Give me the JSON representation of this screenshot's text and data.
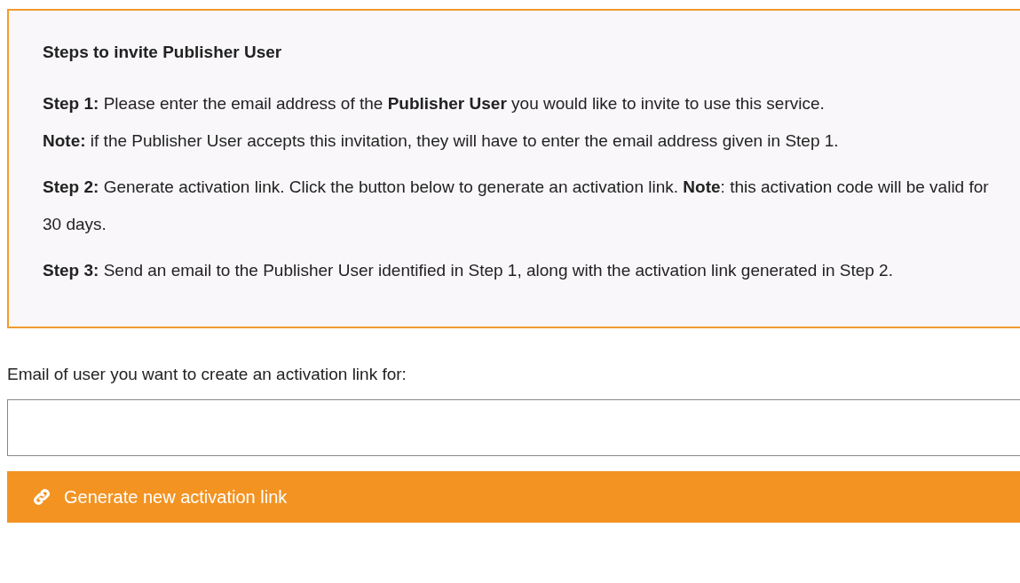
{
  "instructions": {
    "title": "Steps to invite Publisher User",
    "steps": [
      {
        "lines": [
          "**Step 1:** Please enter the email address of the **Publisher User** you would like to invite to use this service.",
          "**Note:** if the Publisher User accepts this invitation, they will have to enter the email address given in Step 1."
        ]
      },
      {
        "lines": [
          "**Step 2:** Generate activation link. Click the button below to generate an activation link. **Note**: this activation code will be valid for 30 days."
        ]
      },
      {
        "lines": [
          "**Step 3:** Send an email to the Publisher User identified in Step 1, along with the activation link generated in Step 2."
        ]
      }
    ]
  },
  "email_field": {
    "label": "Email of user you want to create an activation link for:"
  },
  "generate_button": {
    "label": "Generate new activation link"
  }
}
